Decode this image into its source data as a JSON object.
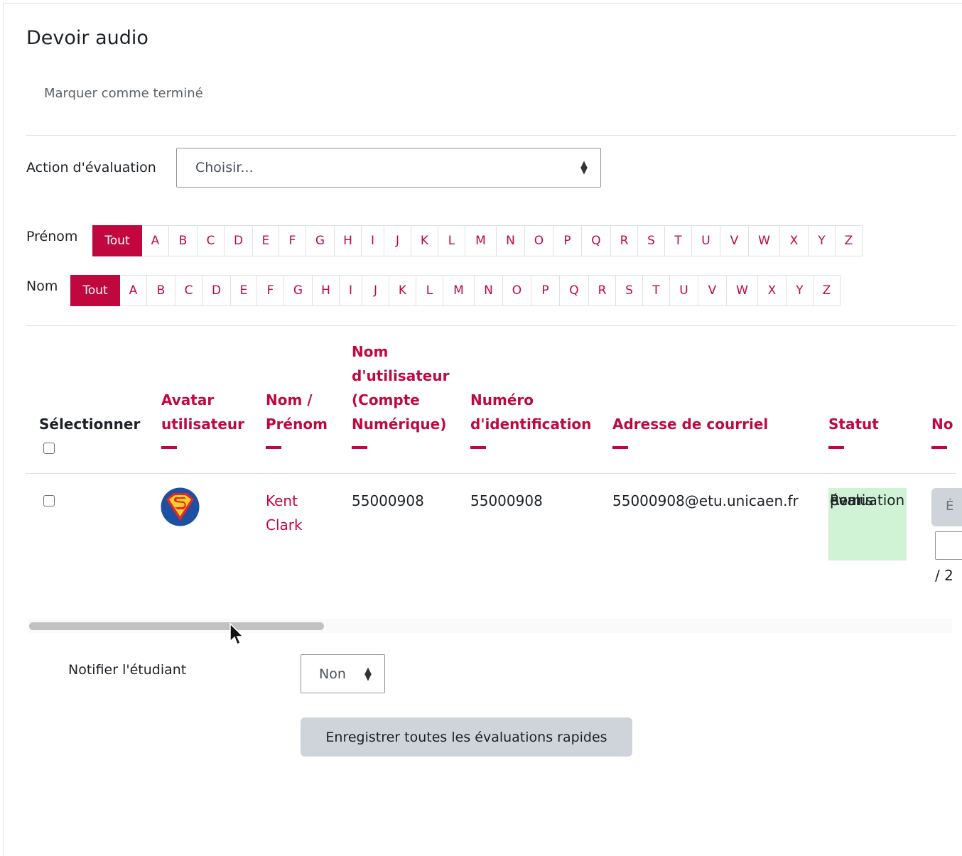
{
  "page": {
    "title": "Devoir audio",
    "mark_done": "Marquer comme terminé"
  },
  "grading_action": {
    "label": "Action d'évaluation",
    "selected": "Choisir..."
  },
  "filters": {
    "first_name_label": "Prénom",
    "last_name_label": "Nom",
    "all_label": "Tout",
    "letters": [
      "A",
      "B",
      "C",
      "D",
      "E",
      "F",
      "G",
      "H",
      "I",
      "J",
      "K",
      "L",
      "M",
      "N",
      "O",
      "P",
      "Q",
      "R",
      "S",
      "T",
      "U",
      "V",
      "W",
      "X",
      "Y",
      "Z"
    ]
  },
  "table": {
    "headers": {
      "select": "Sélectionner",
      "avatar_1": "Avatar",
      "avatar_2": "utilisateur",
      "name_1": "Nom /",
      "name_2": "Prénom",
      "username_1": "Nom",
      "username_2": "d'utilisateur",
      "username_3": "(Compte",
      "username_4": "Numérique)",
      "idnumber_1": "Numéro",
      "idnumber_2": "d'identification",
      "email": "Adresse de courriel",
      "status": "Statut",
      "grade": "No"
    },
    "rows": [
      {
        "name_1": "Kent",
        "name_2": "Clark",
        "username": "55000908",
        "idnumber": "55000908",
        "email": "55000908@etu.unicaen.fr",
        "status_1": "Remis",
        "status_2": "pour",
        "status_3": "évaluation",
        "grade_button": "É",
        "grade_of": "/ 2"
      }
    ]
  },
  "notify": {
    "label": "Notifier l'étudiant",
    "selected": "Non"
  },
  "save_button": "Enregistrer toutes les évaluations rapides",
  "colors": {
    "accent": "#c0083f",
    "status_bg": "#d0f2d5",
    "button_bg": "#ced4da"
  }
}
